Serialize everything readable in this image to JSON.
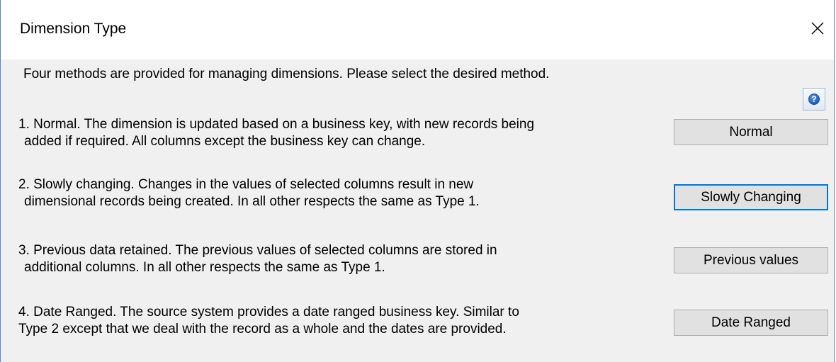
{
  "window": {
    "title": "Dimension Type",
    "close_icon": "close-icon"
  },
  "intro_text": "Four methods are provided for managing dimensions. Please select the desired method.",
  "help": {
    "icon": "help-question-icon",
    "glyph": "?"
  },
  "options": [
    {
      "line1": "1. Normal. The dimension is updated based on a business key, with new records being",
      "line2": "added if required. All columns except the business key can change.",
      "button_label": "Normal"
    },
    {
      "line1": "2. Slowly changing. Changes in the values of selected columns result in new",
      "line2": "dimensional records being created. In all other respects the same as Type 1.",
      "button_label": "Slowly Changing"
    },
    {
      "line1": "3. Previous data retained. The previous values of selected columns are stored in",
      "line2": "additional columns. In all other respects the same as Type 1.",
      "button_label": "Previous values"
    },
    {
      "line1": "4. Date Ranged. The source system provides a date ranged business key. Similar to",
      "line2": "Type 2 except that we deal with the record as a whole and the dates are provided.",
      "button_label": "Date Ranged"
    }
  ],
  "colors": {
    "dialog_bg": "#f0f0f0",
    "button_bg": "#e1e1e1",
    "focus_border": "#0078d7"
  }
}
